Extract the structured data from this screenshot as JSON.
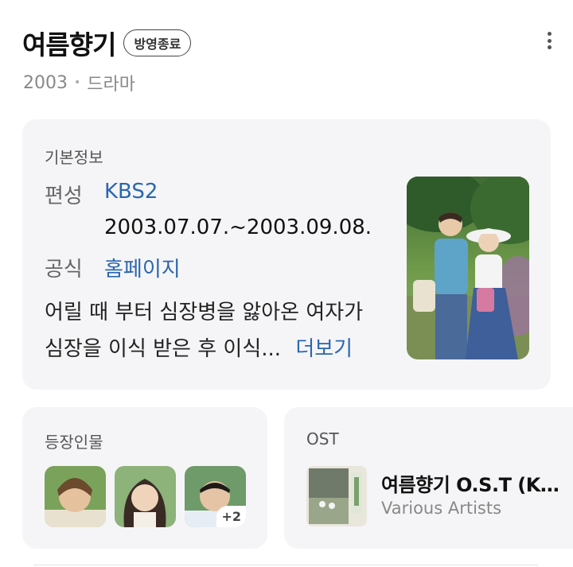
{
  "header": {
    "title": "여름향기",
    "badge": "방영종료",
    "year": "2003",
    "separator": "•",
    "genre": "드라마"
  },
  "info": {
    "heading": "기본정보",
    "network_label": "편성",
    "network_value": "KBS2",
    "dates": "2003.07.07.~2003.09.08.",
    "official_label": "공식",
    "official_value": "홈페이지",
    "synopsis_line1": "어릴 때 부터 심장병을 앓아온 여자가",
    "synopsis_line2": "심장을 이식 받은 후 이식...",
    "more_label": "더보기"
  },
  "cast": {
    "heading": "등장인물",
    "extra_count": "+2",
    "avatars": [
      "avatar-1",
      "avatar-2",
      "avatar-3"
    ]
  },
  "ost": {
    "heading": "OST",
    "title": "여름향기 O.S.T (KBS ...",
    "artist": "Various Artists"
  },
  "icons": {
    "menu": "more-vertical-icon"
  },
  "colors": {
    "link": "#2b66b0",
    "card_bg": "#f5f5f7"
  }
}
